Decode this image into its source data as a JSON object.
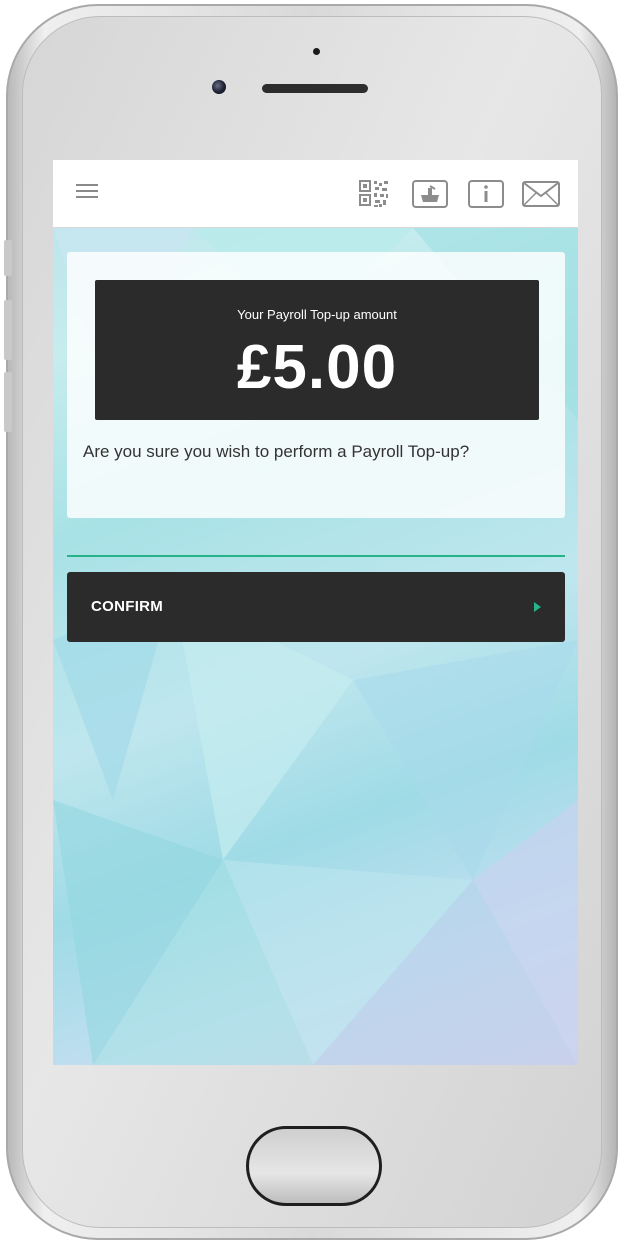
{
  "header": {
    "menu_icon": "hamburger-menu-icon",
    "icons": [
      "qr-code-icon",
      "card-reader-icon",
      "info-icon",
      "mail-icon"
    ]
  },
  "topup": {
    "amount_label": "Your Payroll Top-up amount",
    "amount_value": "£5.00",
    "question": "Are you sure you wish to perform a Payroll Top-up?"
  },
  "actions": {
    "confirm_label": "CONFIRM",
    "confirm_icon": "chevron-right-icon"
  },
  "colors": {
    "accent": "#27b38a",
    "dark_panel": "#2b2b2b",
    "header_bg": "#ffffff"
  }
}
